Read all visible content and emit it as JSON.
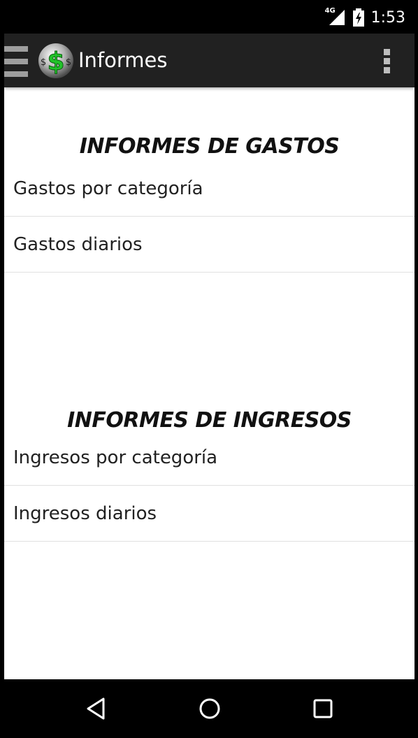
{
  "status_bar": {
    "network_type": "4G",
    "time": "1:53"
  },
  "action_bar": {
    "title": "Informes",
    "logo_text": "$"
  },
  "sections": [
    {
      "title": "INFORMES DE GASTOS",
      "items": [
        "Gastos por categoría",
        "Gastos diarios"
      ]
    },
    {
      "title": "INFORMES DE INGRESOS",
      "items": [
        "Ingresos por categoría",
        "Ingresos diarios"
      ]
    }
  ],
  "colors": {
    "action_bar": "#212121",
    "logo_dollar": "#22c32a",
    "divider": "#e0e0e0"
  },
  "icons": {
    "menu": "hamburger-icon",
    "overflow": "more-vert-icon",
    "nav_back": "back-icon",
    "nav_home": "home-icon",
    "nav_recents": "recents-icon"
  }
}
